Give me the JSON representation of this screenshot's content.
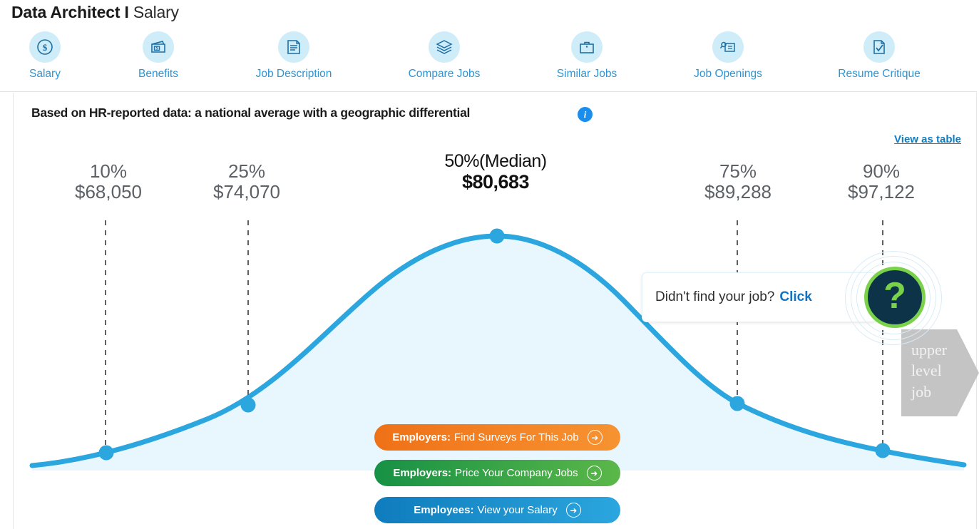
{
  "header": {
    "title_bold": "Data Architect I",
    "title_rest": " Salary"
  },
  "nav": {
    "items": [
      {
        "label": "Salary",
        "icon": "dollar-coin-icon"
      },
      {
        "label": "Benefits",
        "icon": "wallet-icon"
      },
      {
        "label": "Job Description",
        "icon": "document-icon"
      },
      {
        "label": "Compare Jobs",
        "icon": "layers-icon"
      },
      {
        "label": "Similar Jobs",
        "icon": "briefcase-icon"
      },
      {
        "label": "Job Openings",
        "icon": "person-search-card-icon"
      },
      {
        "label": "Resume Critique",
        "icon": "document-check-icon"
      }
    ]
  },
  "card": {
    "subtitle": "Based on HR-reported data: a national average with a geographic differential",
    "info_icon": "info-icon",
    "view_as_table": "View as table"
  },
  "chart_data": {
    "type": "area",
    "title": "Data Architect I Salary",
    "subtitle": "Based on HR-reported data: a national average with a geographic differential",
    "xlabel": "",
    "ylabel": "",
    "grid": false,
    "legend": null,
    "currency": "USD",
    "categories": [
      "10%",
      "25%",
      "50%(Median)",
      "75%",
      "90%"
    ],
    "percentile_labels": [
      "10%",
      "25%",
      "50%(Median)",
      "75%",
      "90%"
    ],
    "values": [
      68050,
      74070,
      80683,
      89288,
      97122
    ],
    "value_labels": [
      "$68,050",
      "$74,070",
      "$80,683",
      "$89,288",
      "$97,122"
    ],
    "markers": [
      {
        "percentile": "10%",
        "value_label": "$68,050",
        "value": 68050
      },
      {
        "percentile": "25%",
        "value_label": "$74,070",
        "value": 74070
      },
      {
        "percentile": "50%(Median)",
        "value_label": "$80,683",
        "value": 80683
      },
      {
        "percentile": "75%",
        "value_label": "$89,288",
        "value": 89288
      },
      {
        "percentile": "90%",
        "value_label": "$97,122",
        "value": 97122
      }
    ],
    "curve_color": "#2ba6de",
    "fill_color": "#e8f6fd",
    "marker_color": "#2ba6de",
    "guideline_style": "dashed",
    "guideline_color": "#5b6166"
  },
  "cta": [
    {
      "strong": "Employers:",
      "text": "Find Surveys For This Job",
      "color": "#ef7117",
      "arrow": "arrow-right-icon"
    },
    {
      "strong": "Employers:",
      "text": "Price Your Company Jobs",
      "color": "#179145",
      "arrow": "arrow-right-icon"
    },
    {
      "strong": "Employees:",
      "text": "View your Salary",
      "color": "#0f7cbd",
      "arrow": "arrow-right-icon"
    }
  ],
  "help": {
    "question": "Didn't find your job?",
    "click": "Click",
    "badge_glyph": "?",
    "badge_color": "#7ad24b",
    "badge_bg": "#0d3349"
  },
  "upper_arrow": {
    "line1": "upper",
    "line2": "level",
    "line3": "job"
  }
}
